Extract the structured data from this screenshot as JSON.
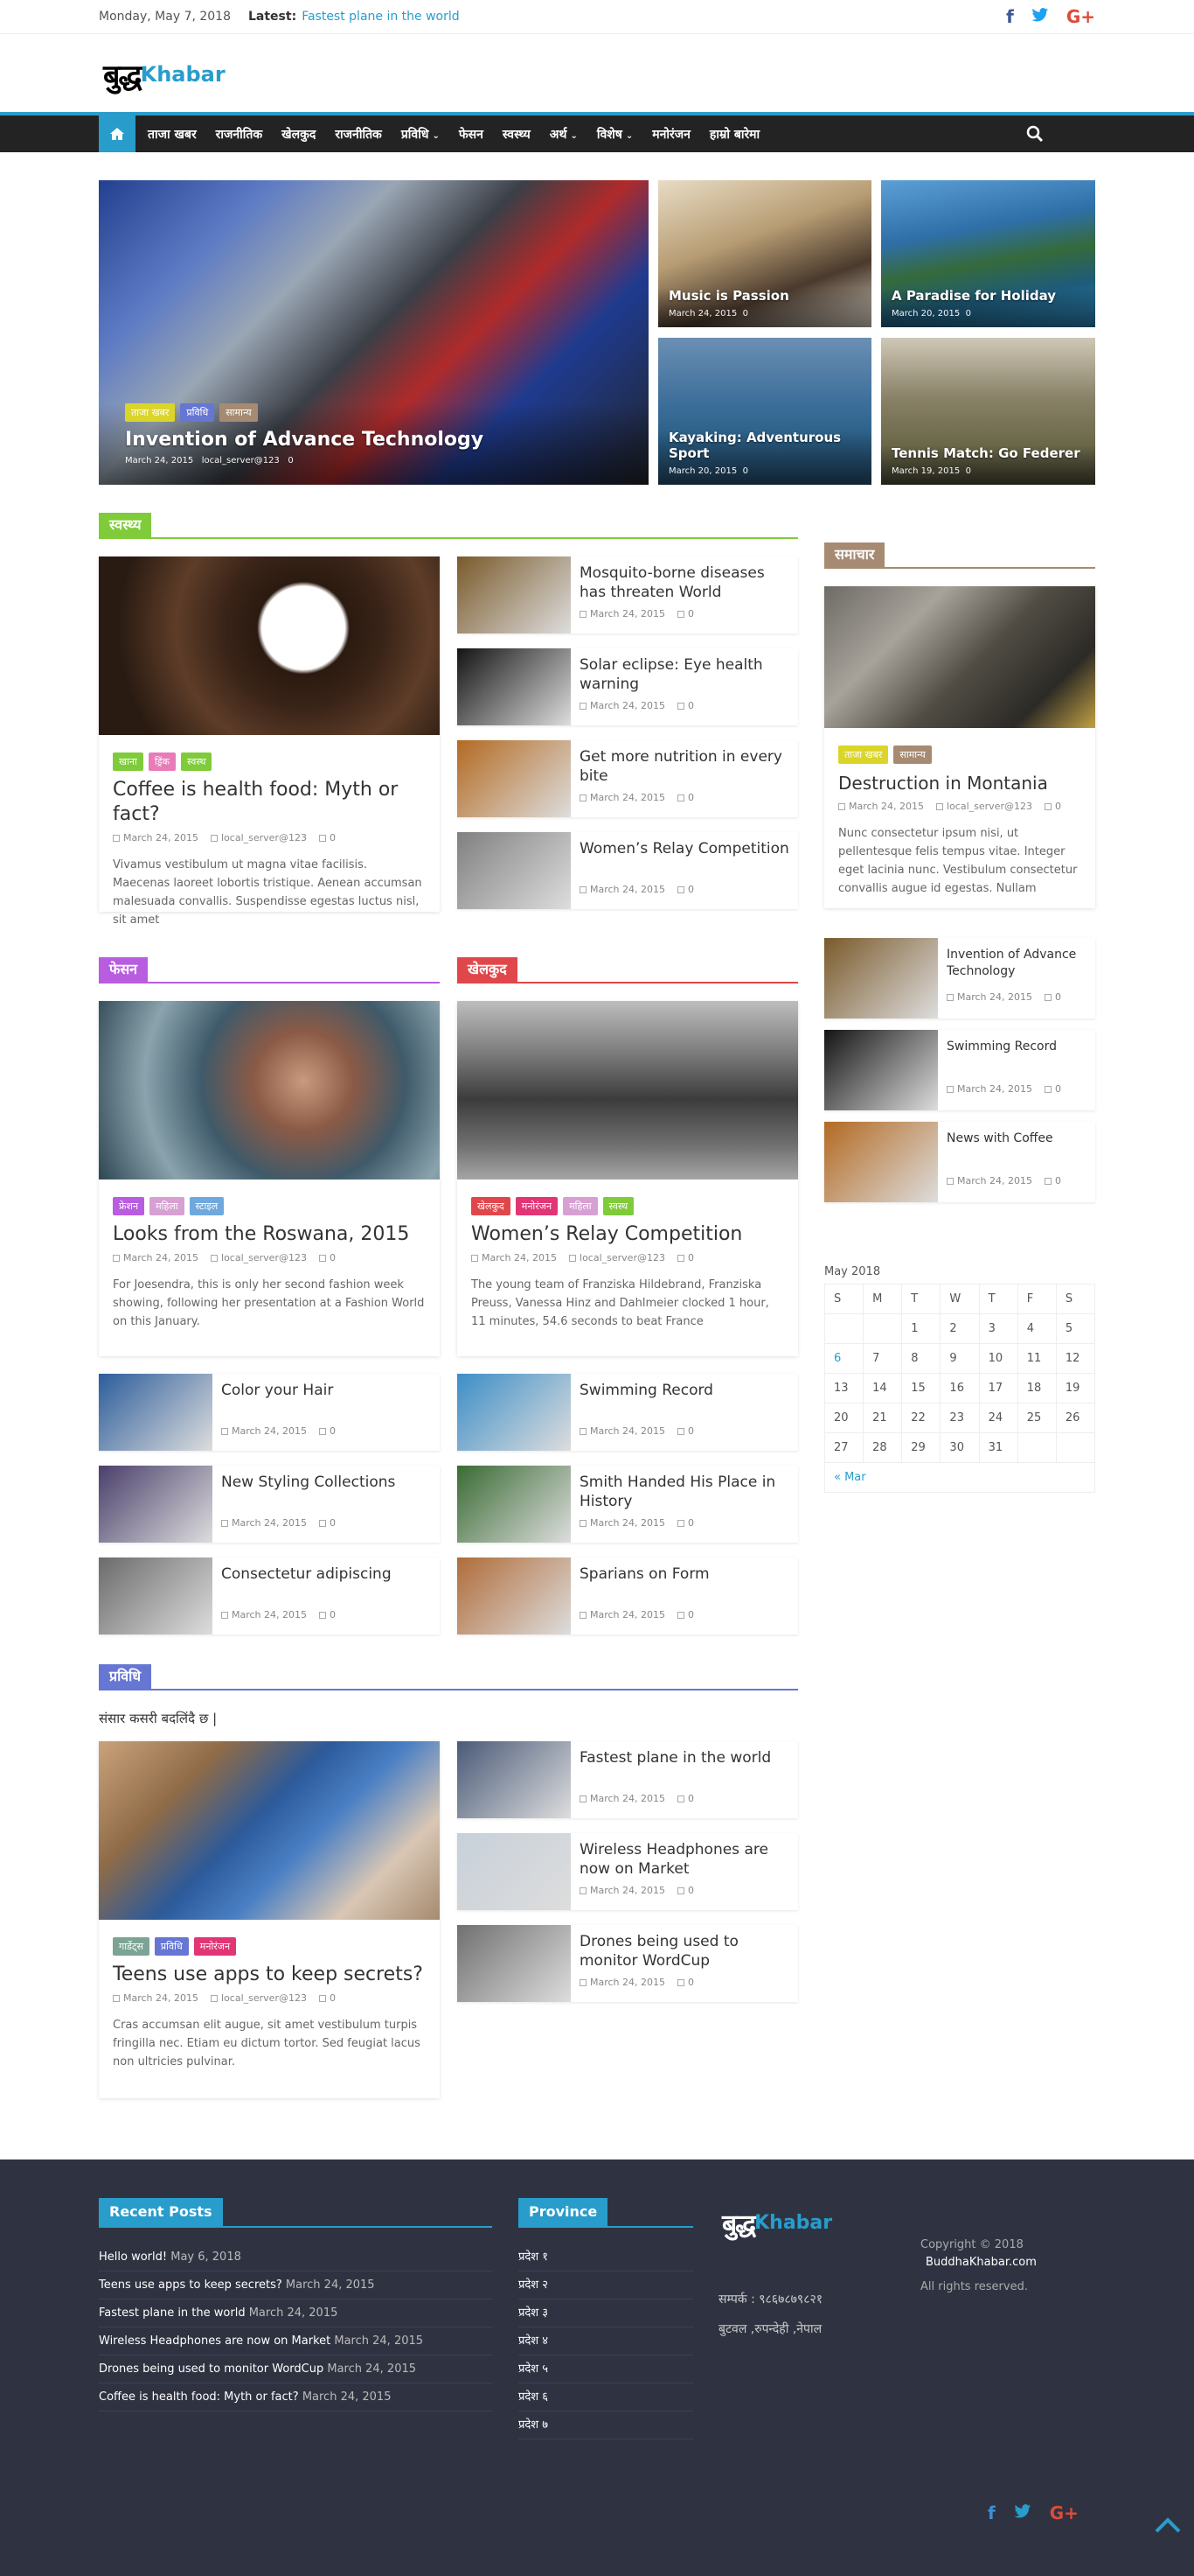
{
  "topbar": {
    "date": "Monday, May 7, 2018",
    "latest_label": "Latest:",
    "latest_news": "Fastest plane in the world"
  },
  "brand": {
    "logo_dev": "बुद्ध",
    "logo_en": "Khabar"
  },
  "nav": {
    "items": [
      "ताजा खबर",
      "राजनीतिक",
      "खेलकुद",
      "राजनीतिक",
      "प्रविधि",
      "फेसन",
      "स्वस्थ्य",
      "अर्थ",
      "विशेष",
      "मनोरंजन",
      "हाम्रो बारेमा"
    ],
    "dropdown_flags": [
      false,
      false,
      false,
      false,
      true,
      false,
      false,
      true,
      true,
      false,
      false
    ]
  },
  "colors": {
    "accent": "#289dcc",
    "nav_bg": "#232323",
    "health": "#7fcb3a",
    "fashion": "#b85ce0",
    "sports": "#e0474b",
    "tech": "#6676d3",
    "news": "#a68b72",
    "footer_bg": "#2f3341"
  },
  "hero": {
    "main": {
      "cats": [
        "ताजा खबर",
        "प्रविधि",
        "सामान्य"
      ],
      "title": "Invention of Advance Technology",
      "date": "March 24, 2015",
      "author": "local_server@123",
      "comments": "0"
    },
    "tiles": [
      {
        "title": "Music is Passion",
        "date": "March 24, 2015",
        "comments": "0"
      },
      {
        "title": "A Paradise for Holiday",
        "date": "March 20, 2015",
        "comments": "0"
      },
      {
        "title": "Kayaking: Adventurous Sport",
        "date": "March 20, 2015",
        "comments": "0"
      },
      {
        "title": "Tennis Match: Go Federer",
        "date": "March 19, 2015",
        "comments": "0"
      }
    ]
  },
  "health": {
    "heading": "स्वस्थ्य",
    "feature": {
      "cats": [
        "खाना",
        "ड्रिंक",
        "स्वस्थ"
      ],
      "title": "Coffee is health food: Myth or fact?",
      "date": "March 24, 2015",
      "author": "local_server@123",
      "comments": "0",
      "excerpt": "Vivamus vestibulum ut magna vitae facilisis. Maecenas laoreet lobortis tristique. Aenean accumsan malesuada convallis. Suspendisse egestas luctus nisl, sit amet"
    },
    "list": [
      {
        "title": "Mosquito-borne diseases has threaten World",
        "date": "March 24, 2015",
        "comments": "0"
      },
      {
        "title": "Solar eclipse: Eye health warning",
        "date": "March 24, 2015",
        "comments": "0"
      },
      {
        "title": "Get more nutrition in every bite",
        "date": "March 24, 2015",
        "comments": "0"
      },
      {
        "title": "Women’s Relay Competition",
        "date": "March 24, 2015",
        "comments": "0"
      }
    ]
  },
  "fashion": {
    "heading": "फेसन",
    "feature": {
      "cats": [
        "फ्रेशन",
        "महिला",
        "स्टाइल"
      ],
      "title": "Looks from the Roswana, 2015",
      "date": "March 24, 2015",
      "author": "local_server@123",
      "comments": "0",
      "excerpt": "For Joesendra, this is only her second fashion week showing, following her presentation at a Fashion World on this January."
    },
    "list": [
      {
        "title": "Color your Hair",
        "date": "March 24, 2015",
        "comments": "0"
      },
      {
        "title": "New Styling Collections",
        "date": "March 24, 2015",
        "comments": "0"
      },
      {
        "title": "Consectetur adipiscing",
        "date": "March 24, 2015",
        "comments": "0"
      }
    ]
  },
  "sports": {
    "heading": "खेलकुद",
    "feature": {
      "cats": [
        "खेलकुद",
        "मनोरंजन",
        "महिला",
        "स्वस्थ"
      ],
      "title": "Women’s Relay Competition",
      "date": "March 24, 2015",
      "author": "local_server@123",
      "comments": "0",
      "excerpt": "The young team of Franziska Hildebrand, Franziska Preuss, Vanessa Hinz and Dahlmeier clocked 1 hour, 11 minutes, 54.6 seconds to beat France"
    },
    "list": [
      {
        "title": "Swimming Record",
        "date": "March 24, 2015",
        "comments": "0"
      },
      {
        "title": "Smith Handed His Place in History",
        "date": "March 24, 2015",
        "comments": "0"
      },
      {
        "title": "Sparians on Form",
        "date": "March 24, 2015",
        "comments": "0"
      }
    ]
  },
  "tech": {
    "heading": "प्रविधि",
    "subtitle": "संसार कसरी बदलिंदै छ |",
    "feature": {
      "cats": [
        "गार्डेट्स",
        "प्रविधि",
        "मनोरंजन"
      ],
      "title": "Teens use apps to keep secrets?",
      "date": "March 24, 2015",
      "author": "local_server@123",
      "comments": "0",
      "excerpt": "Cras accumsan elit augue, sit amet vestibulum turpis fringilla nec. Etiam eu dictum tortor. Sed feugiat lacus non ultricies pulvinar."
    },
    "list": [
      {
        "title": "Fastest plane in the world",
        "date": "March 24, 2015",
        "comments": "0"
      },
      {
        "title": "Wireless Headphones are now on Market",
        "date": "March 24, 2015",
        "comments": "0"
      },
      {
        "title": "Drones being used to monitor WordCup",
        "date": "March 24, 2015",
        "comments": "0"
      }
    ]
  },
  "sidebar": {
    "heading": "समाचार",
    "feature": {
      "cats": [
        "ताजा खबर",
        "सामान्य"
      ],
      "title": "Destruction in Montania",
      "date": "March 24, 2015",
      "author": "local_server@123",
      "comments": "0",
      "excerpt": "Nunc consectetur ipsum nisi, ut pellentesque felis tempus vitae. Integer eget lacinia nunc. Vestibulum consectetur convallis augue id egestas. Nullam"
    },
    "list": [
      {
        "title": "Invention of Advance Technology",
        "date": "March 24, 2015",
        "comments": "0"
      },
      {
        "title": "Swimming Record",
        "date": "March 24, 2015",
        "comments": "0"
      },
      {
        "title": "News with Coffee",
        "date": "March 24, 2015",
        "comments": "0"
      }
    ]
  },
  "calendar": {
    "caption": "May 2018",
    "days": [
      "S",
      "M",
      "T",
      "W",
      "T",
      "F",
      "S"
    ],
    "rows": [
      [
        "",
        "",
        "1",
        "2",
        "3",
        "4",
        "5"
      ],
      [
        "6",
        "7",
        "8",
        "9",
        "10",
        "11",
        "12"
      ],
      [
        "13",
        "14",
        "15",
        "16",
        "17",
        "18",
        "19"
      ],
      [
        "20",
        "21",
        "22",
        "23",
        "24",
        "25",
        "26"
      ],
      [
        "27",
        "28",
        "29",
        "30",
        "31",
        "",
        ""
      ]
    ],
    "linked_day": "6",
    "prev": "« Mar"
  },
  "footer": {
    "recent_heading": "Recent Posts",
    "recent": [
      {
        "title": "Hello world!",
        "date": "May 6, 2018"
      },
      {
        "title": "Teens use apps to keep secrets?",
        "date": "March 24, 2015"
      },
      {
        "title": "Fastest plane in the world",
        "date": "March 24, 2015"
      },
      {
        "title": "Wireless Headphones are now on Market",
        "date": "March 24, 2015"
      },
      {
        "title": "Drones being used to monitor WordCup",
        "date": "March 24, 2015"
      },
      {
        "title": "Coffee is health food: Myth or fact?",
        "date": "March 24, 2015"
      }
    ],
    "province_heading": "Province",
    "provinces": [
      "प्रदेश १",
      "प्रदेश २",
      "प्रदेश ३",
      "प्रदेश ४",
      "प्रदेश ५",
      "प्रदेश ६",
      "प्रदेश ७"
    ],
    "contact": "सम्पर्क : ९८६७८७९८२१",
    "address": "बुटवल ,रुपन्देही ,नेपाल",
    "copyright": "Copyright © 2018",
    "site": "BuddhaKhabar.com",
    "rights": "All rights reserved."
  }
}
